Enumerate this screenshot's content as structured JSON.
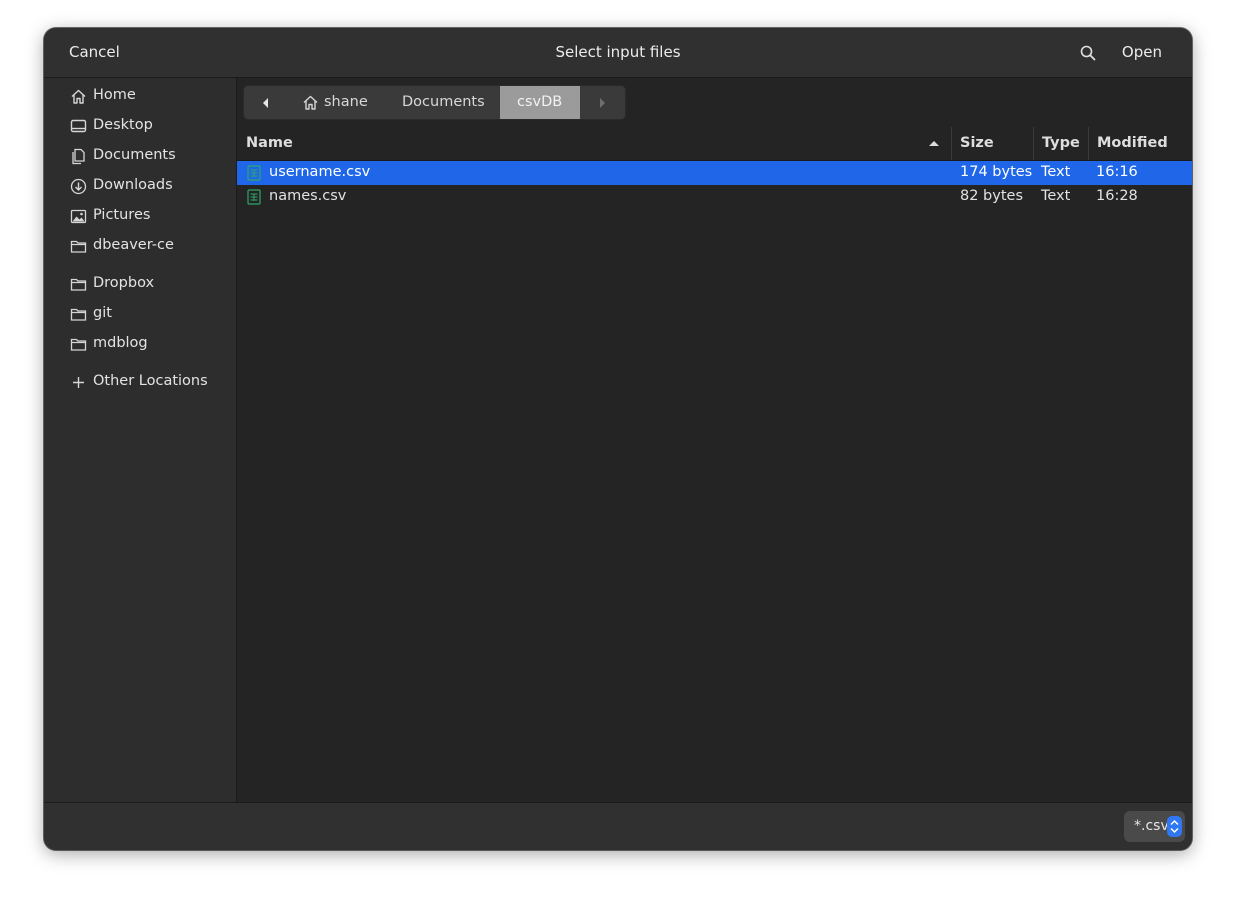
{
  "header": {
    "cancel_label": "Cancel",
    "title": "Select input files",
    "search_icon": "search-icon",
    "open_label": "Open"
  },
  "sidebar": {
    "items": [
      {
        "label": "Home",
        "icon": "home-icon"
      },
      {
        "label": "Desktop",
        "icon": "desktop-icon"
      },
      {
        "label": "Documents",
        "icon": "documents-icon"
      },
      {
        "label": "Downloads",
        "icon": "downloads-icon"
      },
      {
        "label": "Pictures",
        "icon": "pictures-icon"
      },
      {
        "label": "dbeaver-ce",
        "icon": "folder-icon"
      },
      {
        "label": "Dropbox",
        "icon": "folder-icon"
      },
      {
        "label": "git",
        "icon": "folder-icon"
      },
      {
        "label": "mdblog",
        "icon": "folder-icon"
      },
      {
        "label": "Other Locations",
        "icon": "plus-icon"
      }
    ]
  },
  "pathbar": {
    "segments": [
      "shane",
      "Documents",
      "csvDB"
    ],
    "current": "csvDB"
  },
  "columns": {
    "name": "Name",
    "size": "Size",
    "type": "Type",
    "modified": "Modified"
  },
  "files": [
    {
      "name": "username.csv",
      "size": "174 bytes",
      "type": "Text",
      "modified": "16:16",
      "selected": true
    },
    {
      "name": "names.csv",
      "size": "82 bytes",
      "type": "Text",
      "modified": "16:28",
      "selected": false
    }
  ],
  "footer": {
    "filter_label": "*.csv"
  },
  "colors": {
    "selection": "#1f67e8",
    "file_icon": "#2fa56a",
    "background": "#242424"
  }
}
